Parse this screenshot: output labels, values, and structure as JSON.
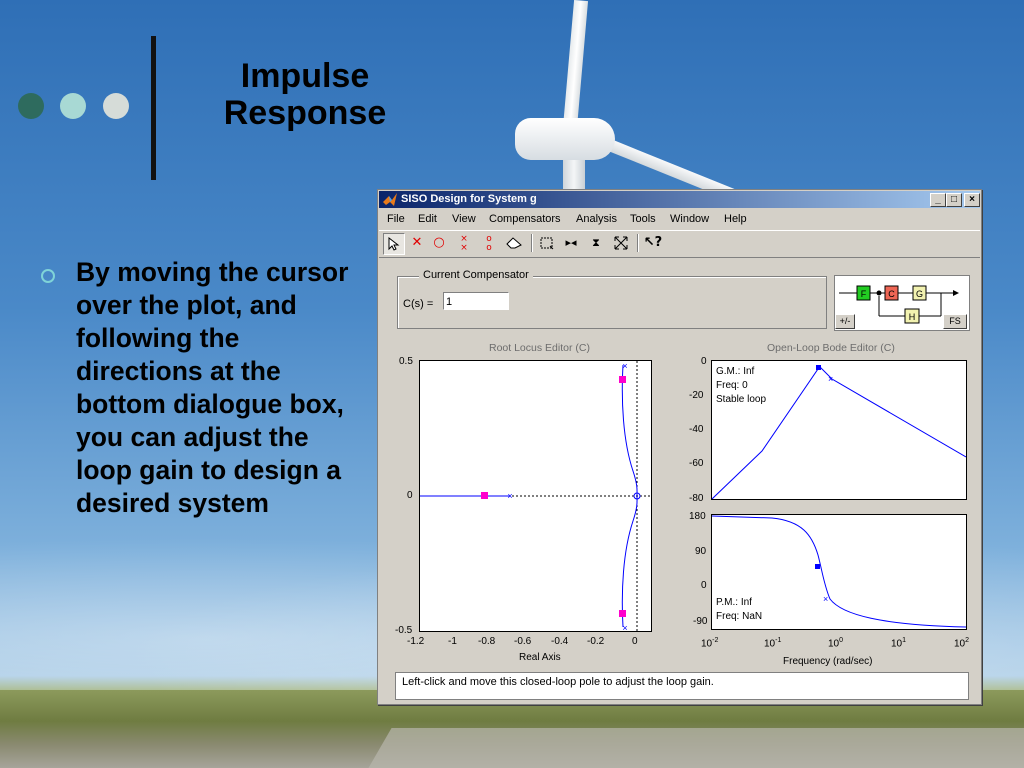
{
  "slide": {
    "title_line1": "Impulse",
    "title_line2": "Response",
    "bullet": "By moving the cursor over the plot, and following the directions at the bottom dialogue box, you can adjust the loop gain to design a desired system",
    "dots": [
      "#2e6b5e",
      "#a8d9d4",
      "#d6dcd8"
    ]
  },
  "window": {
    "title": "SISO Design for System g",
    "buttons": {
      "minimize": "_",
      "maximize": "□",
      "close": "×"
    },
    "menu": [
      "File",
      "Edit",
      "View",
      "Compensators",
      "Analysis",
      "Tools",
      "Window",
      "Help"
    ],
    "toolbar_icons": [
      "select-arrow-icon",
      "add-pole-icon",
      "add-zero-icon",
      "add-complex-pole-icon",
      "add-complex-zero-icon",
      "erase-icon",
      "zoom-xy-icon",
      "zoom-x-icon",
      "zoom-y-icon",
      "zoom-out-icon",
      "whats-this-icon"
    ],
    "compensator": {
      "group_label": "Current Compensator",
      "cs_label": "C(s) =",
      "cs_value": "1"
    },
    "diagram": {
      "blocks": [
        "F",
        "C",
        "G",
        "H"
      ],
      "sign_button": "+/-",
      "fs_button": "FS",
      "block_colors": {
        "F": "#22cc22",
        "C": "#ee6655",
        "G": "#f2f2b0",
        "H": "#f2f2b0"
      }
    },
    "root_locus": {
      "title": "Root Locus Editor (C)",
      "xlabel": "Real Axis",
      "xticks": [
        "-1.2",
        "-1",
        "-0.8",
        "-0.6",
        "-0.4",
        "-0.2",
        "0"
      ],
      "yticks": [
        "0.5",
        "0",
        "-0.5"
      ]
    },
    "bode": {
      "title": "Open-Loop Bode Editor (C)",
      "mag_yticks": [
        "0",
        "-20",
        "-40",
        "-60",
        "-80"
      ],
      "phase_yticks": [
        "180",
        "90",
        "0",
        "-90"
      ],
      "xticks": [
        "10",
        "10",
        "10",
        "10",
        "10"
      ],
      "xtick_exps": [
        "-2",
        "-1",
        "0",
        "1",
        "2"
      ],
      "xlabel": "Frequency (rad/sec)",
      "mag_annotations": [
        "G.M.: Inf",
        "Freq: 0",
        "Stable loop"
      ],
      "phase_annotations": [
        "P.M.: Inf",
        "Freq: NaN"
      ]
    },
    "status": "Left-click and move this closed-loop pole to adjust the loop gain."
  },
  "colors": {
    "curve": "#0000ff",
    "pole_marker": "#ff00cc"
  }
}
